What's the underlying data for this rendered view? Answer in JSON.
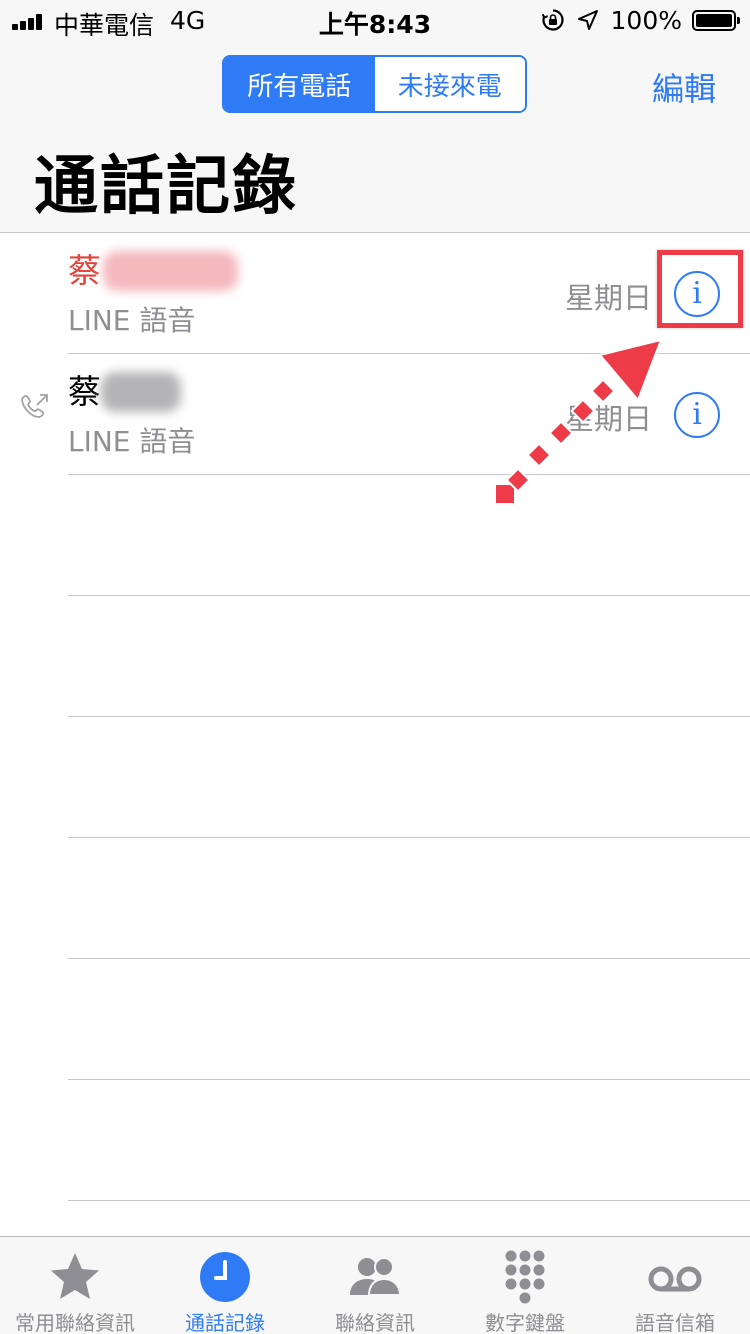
{
  "status_bar": {
    "carrier": "中華電信",
    "network": "4G",
    "time": "上午8:43",
    "battery": "100%"
  },
  "header": {
    "segments": [
      "所有電話",
      "未接來電"
    ],
    "active_segment": "所有電話",
    "edit_label": "編輯",
    "title": "通話記錄"
  },
  "calls": [
    {
      "name": "蔡",
      "name_redacted": true,
      "missed": true,
      "type": "LINE 語音",
      "date": "星期日"
    },
    {
      "name": "蔡",
      "name_redacted": true,
      "missed": false,
      "outgoing": true,
      "type": "LINE 語音",
      "date": "星期日"
    }
  ],
  "tab_bar": {
    "items": [
      {
        "label": "常用聯絡資訊",
        "icon": "star-icon"
      },
      {
        "label": "通話記錄",
        "icon": "clock-icon",
        "active": true
      },
      {
        "label": "聯絡資訊",
        "icon": "contacts-icon"
      },
      {
        "label": "數字鍵盤",
        "icon": "keypad-icon"
      },
      {
        "label": "語音信箱",
        "icon": "voicemail-icon"
      }
    ]
  },
  "colors": {
    "accent": "#2f7bf5",
    "missed": "#e3443d",
    "annotation": "#ee3b48",
    "secondary_text": "#8e8e93"
  }
}
